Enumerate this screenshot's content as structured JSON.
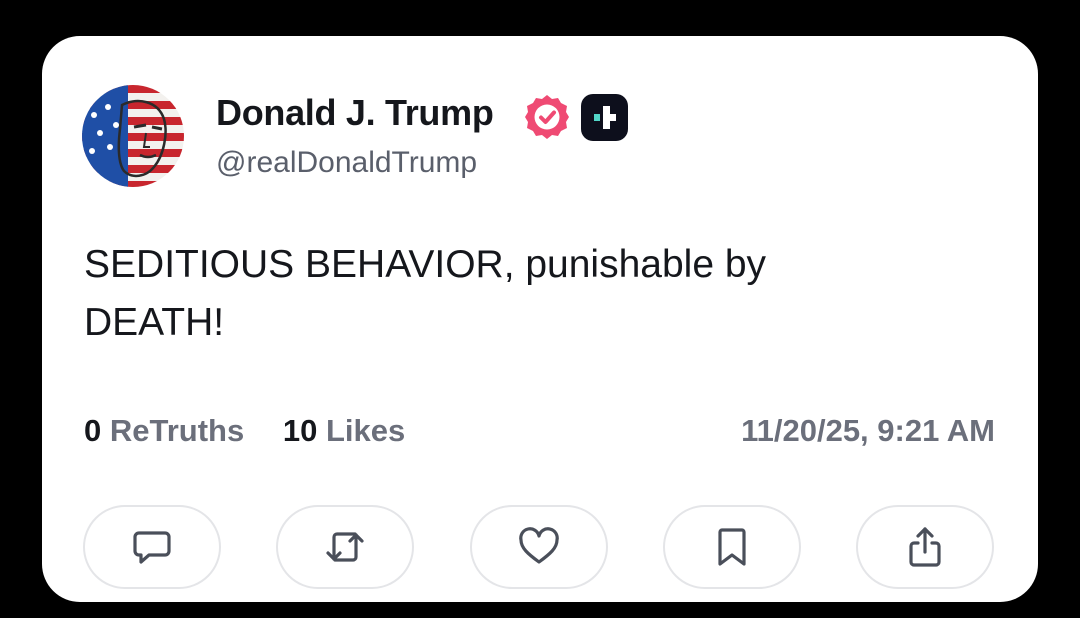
{
  "post": {
    "author": {
      "display_name": "Donald J. Trump",
      "handle": "@realDonaldTrump",
      "verified_badge_color": "#ef4a73",
      "plus_badge_color": "#0d0f1c",
      "plus_badge_accent": "#52d6c8"
    },
    "text_lines": [
      "SEDITIOUS BEHAVIOR, punishable by",
      "DEATH!"
    ],
    "stats": {
      "retruths_count": "0",
      "retruths_label": "ReTruths",
      "likes_count": "10",
      "likes_label": "Likes"
    },
    "timestamp": "11/20/25, 9:21 AM"
  },
  "actions": [
    {
      "name": "reply",
      "icon": "speech-bubble-icon"
    },
    {
      "name": "retruth",
      "icon": "repost-arrows-icon"
    },
    {
      "name": "like",
      "icon": "heart-icon"
    },
    {
      "name": "bookmark",
      "icon": "bookmark-icon"
    },
    {
      "name": "share",
      "icon": "share-icon"
    }
  ],
  "colors": {
    "background": "#000000",
    "card": "#ffffff",
    "text_primary": "#15171c",
    "text_secondary": "#6b6f7b",
    "button_border": "#e4e5e8"
  }
}
